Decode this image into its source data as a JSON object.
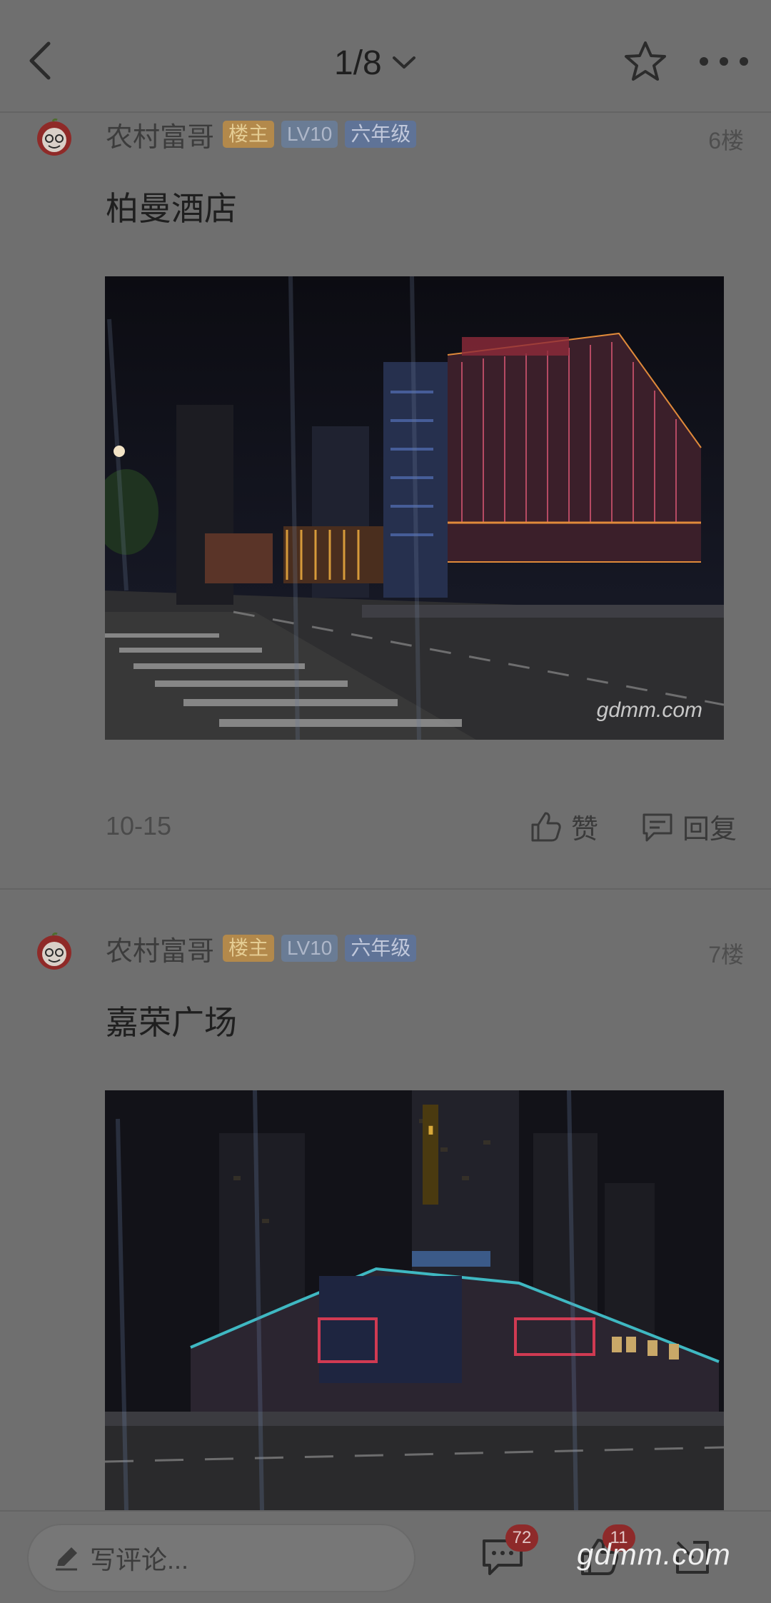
{
  "header": {
    "page_indicator": "1/8"
  },
  "posts": [
    {
      "author": "农村富哥",
      "badges": {
        "owner": "楼主",
        "level": "LV10",
        "grade": "六年级"
      },
      "floor": "6楼",
      "title": "柏曼酒店",
      "photo_watermark": "gdmm.com",
      "date": "10-15",
      "like_label": "赞",
      "reply_label": "回复"
    },
    {
      "author": "农村富哥",
      "badges": {
        "owner": "楼主",
        "level": "LV10",
        "grade": "六年级"
      },
      "floor": "7楼",
      "title": "嘉荣广场"
    }
  ],
  "bottom_bar": {
    "comment_placeholder": "写评论...",
    "comment_count": "72",
    "like_count": "11",
    "watermark": "gdmm.com"
  },
  "colors": {
    "overlay_background": "#6f6f6f",
    "owner_badge": "#b3894b",
    "level_badge": "#6a7c95",
    "count_badge": "#8e2a2a"
  },
  "icons": [
    "back-arrow-icon",
    "chevron-down-icon",
    "star-icon",
    "more-dots-icon",
    "thumbs-up-icon",
    "reply-bubble-icon",
    "pencil-icon",
    "comment-icon",
    "like-icon",
    "share-icon"
  ]
}
